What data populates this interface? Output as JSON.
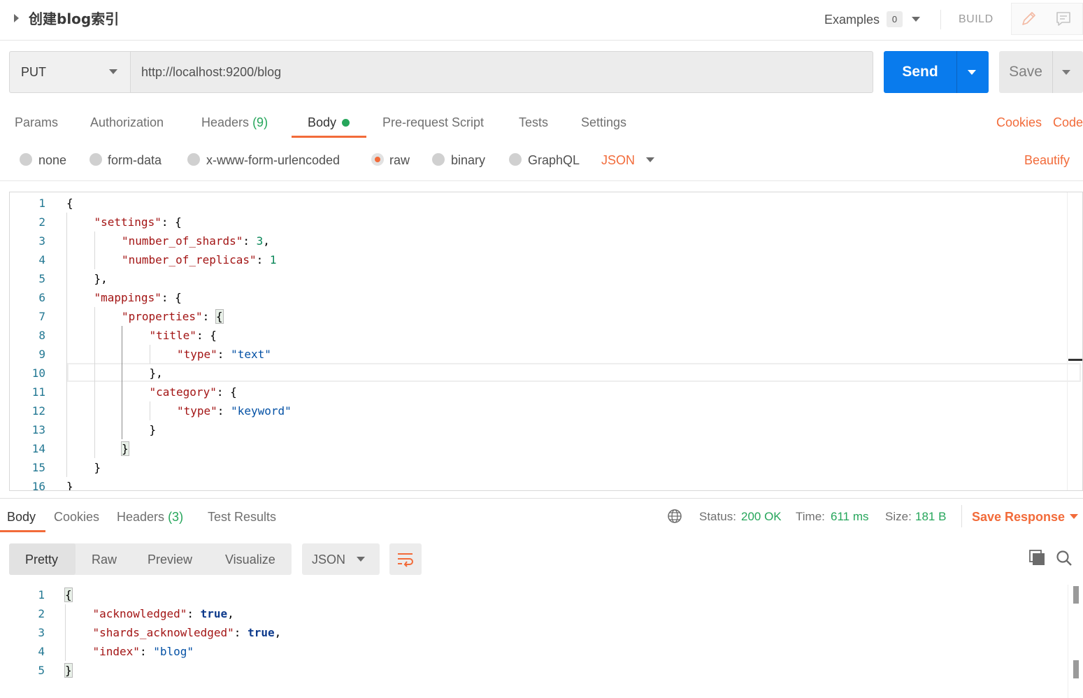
{
  "header": {
    "request_name": "创建blog索引",
    "examples_label": "Examples",
    "examples_count": "0",
    "build_label": "BUILD",
    "icons": [
      "collapse-icon",
      "pencil-icon",
      "comment-icon"
    ]
  },
  "url_bar": {
    "method": "PUT",
    "url": "http://localhost:9200/blog",
    "send_label": "Send",
    "save_label": "Save"
  },
  "request_tabs": {
    "params": "Params",
    "authorization": "Authorization",
    "headers": "Headers",
    "headers_count": "(9)",
    "body": "Body",
    "pre_request": "Pre-request Script",
    "tests": "Tests",
    "settings": "Settings",
    "cookies": "Cookies",
    "code": "Code"
  },
  "body_types": {
    "none": "none",
    "form_data": "form-data",
    "urlencoded": "x-www-form-urlencoded",
    "raw": "raw",
    "binary": "binary",
    "graphql": "GraphQL",
    "selected": "raw",
    "format": "JSON",
    "beautify": "Beautify"
  },
  "request_body": {
    "line_numbers": [
      "1",
      "2",
      "3",
      "4",
      "5",
      "6",
      "7",
      "8",
      "9",
      "10",
      "11",
      "12",
      "13",
      "14",
      "15",
      "16"
    ],
    "lines": [
      [
        {
          "t": "p",
          "v": "{"
        }
      ],
      [
        {
          "t": "k",
          "v": "\"settings\""
        },
        {
          "t": "p",
          "v": ": {"
        }
      ],
      [
        {
          "t": "k",
          "v": "\"number_of_shards\""
        },
        {
          "t": "p",
          "v": ": "
        },
        {
          "t": "n",
          "v": "3"
        },
        {
          "t": "p",
          "v": ","
        }
      ],
      [
        {
          "t": "k",
          "v": "\"number_of_replicas\""
        },
        {
          "t": "p",
          "v": ": "
        },
        {
          "t": "n",
          "v": "1"
        }
      ],
      [
        {
          "t": "p",
          "v": "},"
        }
      ],
      [
        {
          "t": "k",
          "v": "\"mappings\""
        },
        {
          "t": "p",
          "v": ": {"
        }
      ],
      [
        {
          "t": "k",
          "v": "\"properties\""
        },
        {
          "t": "p",
          "v": ": "
        },
        {
          "t": "bm",
          "v": "{"
        }
      ],
      [
        {
          "t": "k",
          "v": "\"title\""
        },
        {
          "t": "p",
          "v": ": {"
        }
      ],
      [
        {
          "t": "k",
          "v": "\"type\""
        },
        {
          "t": "p",
          "v": ": "
        },
        {
          "t": "s",
          "v": "\"text\""
        }
      ],
      [
        {
          "t": "p",
          "v": "},"
        }
      ],
      [
        {
          "t": "k",
          "v": "\"category\""
        },
        {
          "t": "p",
          "v": ": {"
        }
      ],
      [
        {
          "t": "k",
          "v": "\"type\""
        },
        {
          "t": "p",
          "v": ": "
        },
        {
          "t": "s",
          "v": "\"keyword\""
        }
      ],
      [
        {
          "t": "p",
          "v": "}"
        }
      ],
      [
        {
          "t": "bm",
          "v": "}"
        }
      ],
      [
        {
          "t": "p",
          "v": "}"
        }
      ],
      [
        {
          "t": "p",
          "v": "}"
        }
      ]
    ]
  },
  "response_tabs": {
    "body": "Body",
    "cookies": "Cookies",
    "headers": "Headers",
    "headers_count": "(3)",
    "test_results": "Test Results"
  },
  "response_meta": {
    "status_label": "Status:",
    "status_value": "200 OK",
    "time_label": "Time:",
    "time_value": "611 ms",
    "size_label": "Size:",
    "size_value": "181 B",
    "save_response": "Save Response"
  },
  "response_view": {
    "pretty": "Pretty",
    "raw": "Raw",
    "preview": "Preview",
    "visualize": "Visualize",
    "format": "JSON"
  },
  "response_body": {
    "line_numbers": [
      "1",
      "2",
      "3",
      "4",
      "5"
    ],
    "lines": [
      [
        {
          "t": "bm",
          "v": "{"
        }
      ],
      [
        {
          "t": "k",
          "v": "\"acknowledged\""
        },
        {
          "t": "p",
          "v": ": "
        },
        {
          "t": "bt",
          "v": "true"
        },
        {
          "t": "p",
          "v": ","
        }
      ],
      [
        {
          "t": "k",
          "v": "\"shards_acknowledged\""
        },
        {
          "t": "p",
          "v": ": "
        },
        {
          "t": "bt",
          "v": "true"
        },
        {
          "t": "p",
          "v": ","
        }
      ],
      [
        {
          "t": "k",
          "v": "\"index\""
        },
        {
          "t": "p",
          "v": ": "
        },
        {
          "t": "s",
          "v": "\"blog\""
        }
      ],
      [
        {
          "t": "bm",
          "v": "}"
        }
      ]
    ]
  },
  "colors": {
    "accent": "#f26b3a",
    "send_blue": "#097bed",
    "success_green": "#26a65b"
  }
}
